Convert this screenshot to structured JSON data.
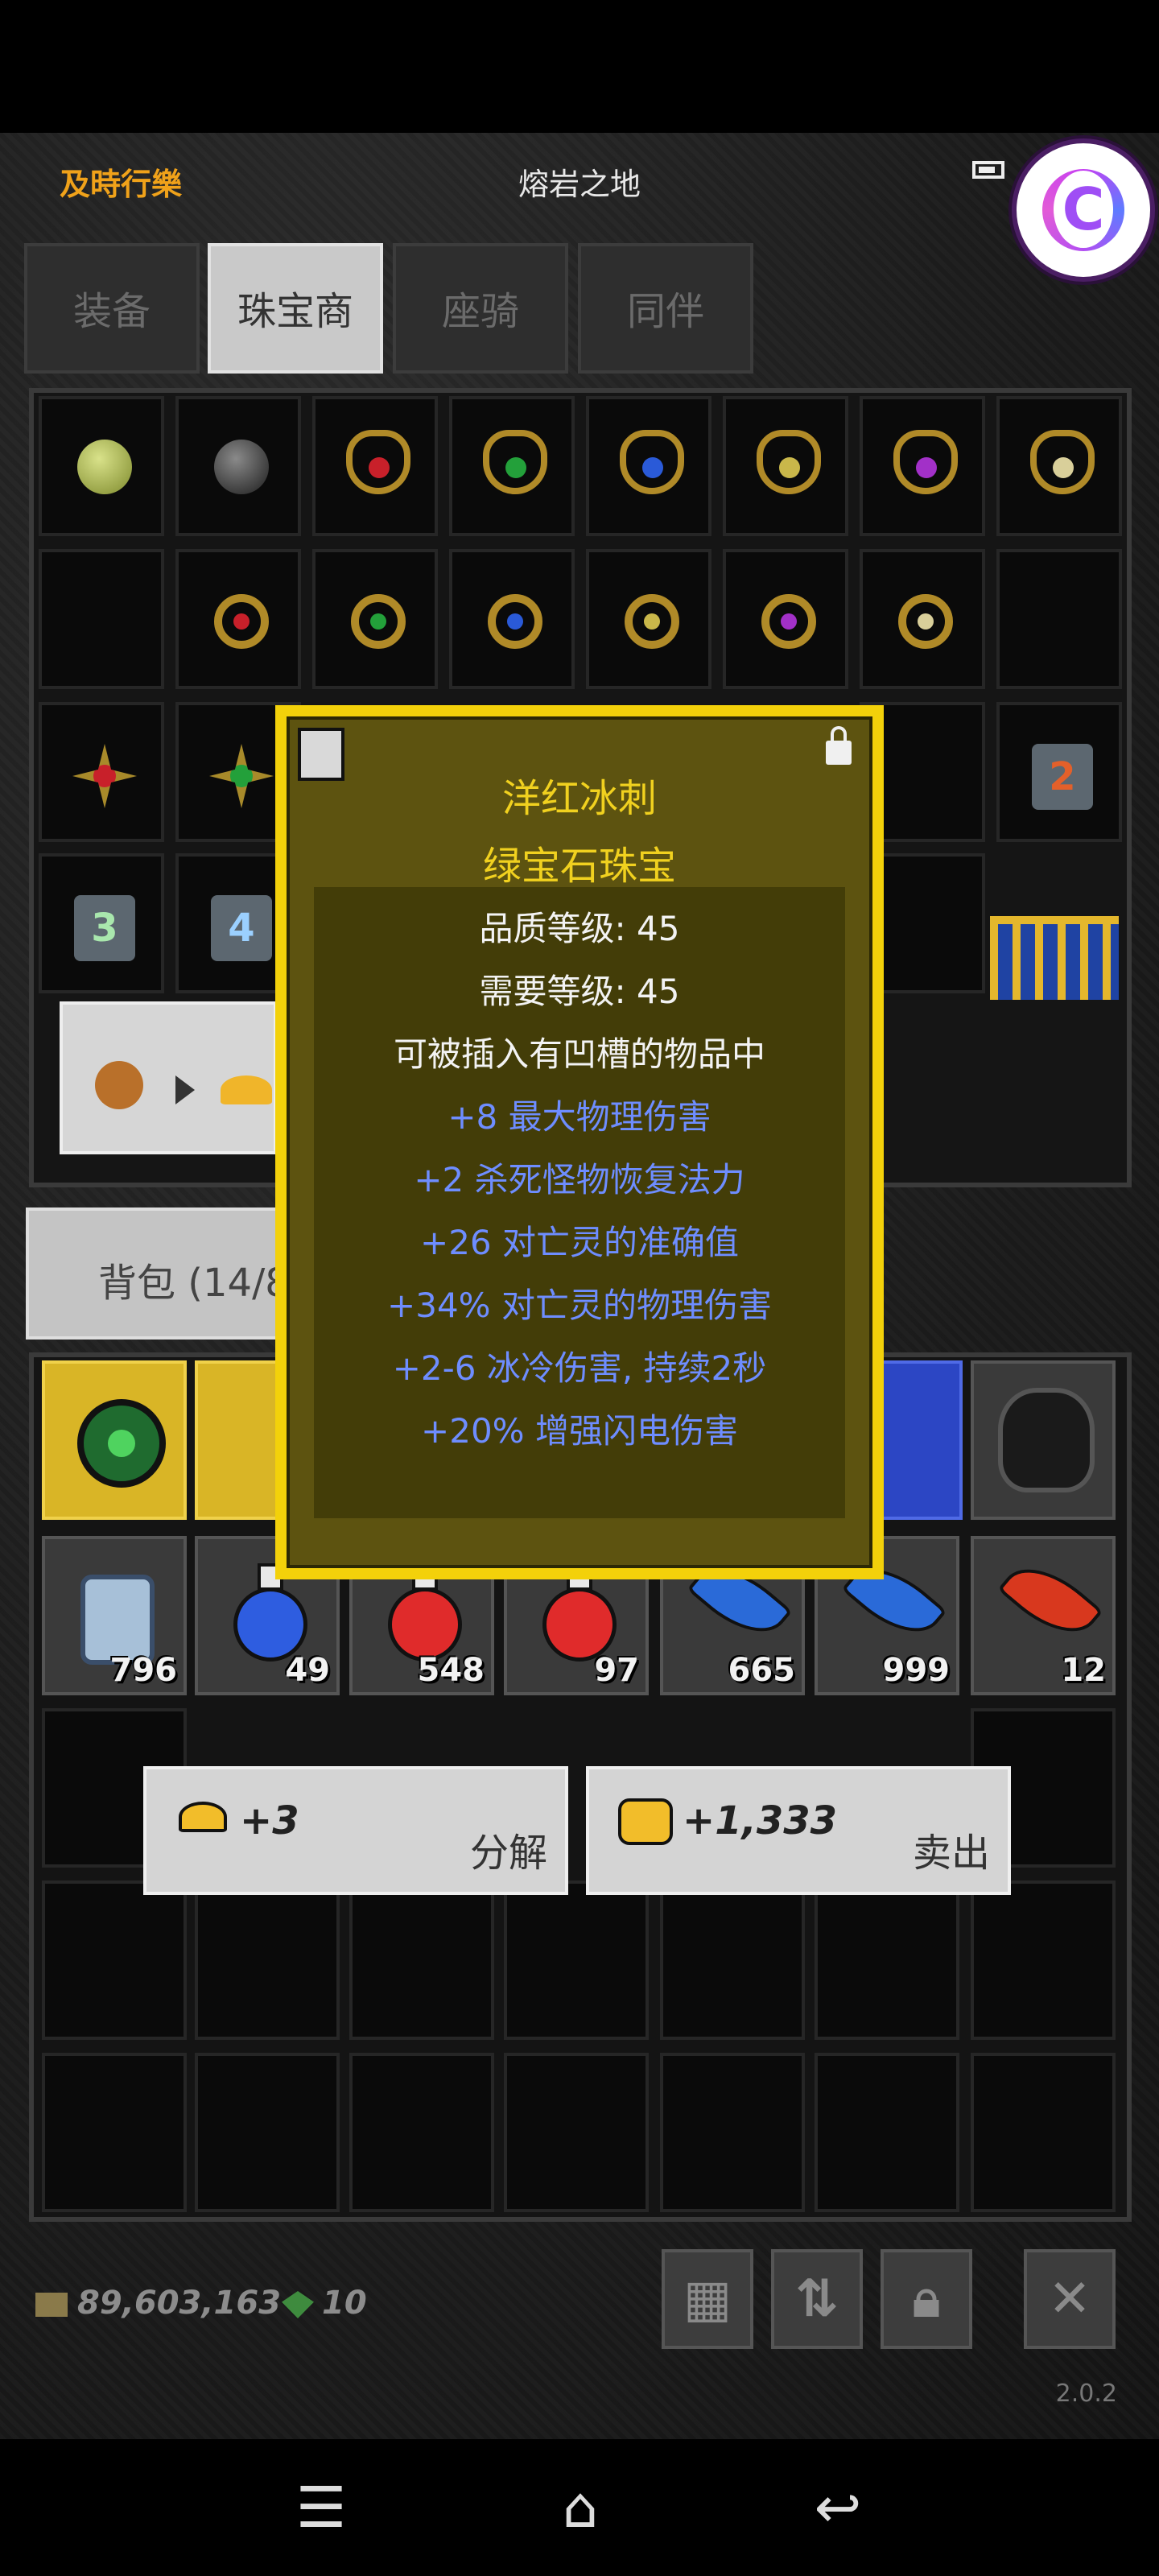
{
  "header": {
    "player_name": "及時行樂",
    "zone": "熔岩之地"
  },
  "tabs": [
    "装备",
    "珠宝商",
    "座骑",
    "同伴"
  ],
  "active_tab": "珠宝商",
  "bag": {
    "title": "背包 (14/8"
  },
  "tooltip": {
    "name": "洋红冰刺",
    "type": "绿宝石珠宝",
    "quality_level": "品质等级: 45",
    "required_level": "需要等级: 45",
    "socket_hint": "可被插入有凹槽的物品中",
    "mods": [
      "+8 最大物理伤害",
      "+2 杀死怪物恢复法力",
      "+26 对亡灵的准确值",
      "+34% 对亡灵的物理伤害",
      "+2-6 冰冷伤害, 持续2秒",
      "+20% 增强闪电伤害"
    ]
  },
  "inventory_counts": [
    "796",
    "49",
    "548",
    "97",
    "665",
    "999",
    "12"
  ],
  "actions": {
    "salvage": {
      "amount": "+3",
      "label": "分解"
    },
    "sell": {
      "amount": "+1,333",
      "label": "卖出"
    }
  },
  "footer": {
    "gold": "89,603,163",
    "gems": "10",
    "version": "2.0.2"
  },
  "colors": {
    "accent_gold": "#f1d11f",
    "player_orange": "#f0a21a",
    "mod_blue": "#6e8dff"
  }
}
